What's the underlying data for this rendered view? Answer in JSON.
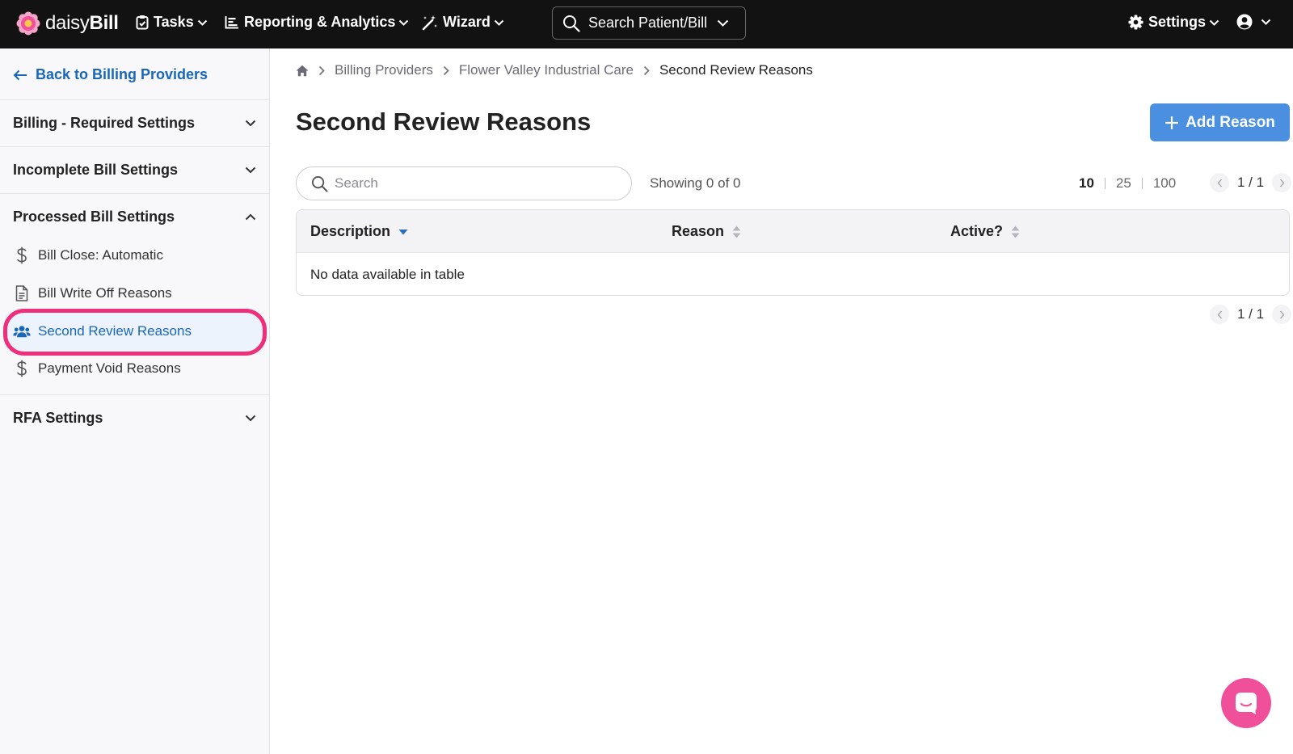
{
  "brand": {
    "name_part1": "daisy",
    "name_part2": "Bill"
  },
  "nav": {
    "tasks": "Tasks",
    "reporting": "Reporting & Analytics",
    "wizard": "Wizard",
    "search": "Search Patient/Bill",
    "settings": "Settings"
  },
  "sidebar": {
    "back_link": "Back to Billing Providers",
    "sections": [
      {
        "label": "Billing - Required Settings",
        "expanded": false
      },
      {
        "label": "Incomplete Bill Settings",
        "expanded": false
      },
      {
        "label": "Processed Bill Settings",
        "expanded": true
      },
      {
        "label": "RFA Settings",
        "expanded": false
      }
    ],
    "items": [
      {
        "label": "Bill Close: Automatic",
        "icon": "dollar-icon"
      },
      {
        "label": "Bill Write Off Reasons",
        "icon": "document-icon"
      },
      {
        "label": "Second Review Reasons",
        "icon": "users-icon",
        "active": true
      },
      {
        "label": "Payment Void Reasons",
        "icon": "dollar-icon"
      }
    ]
  },
  "breadcrumb": {
    "items": [
      "Billing Providers",
      "Flower Valley Industrial Care",
      "Second Review Reasons"
    ]
  },
  "page": {
    "title": "Second Review Reasons",
    "add_button": "Add Reason"
  },
  "table_controls": {
    "search_placeholder": "Search",
    "showing": "Showing 0 of 0",
    "page_sizes": [
      "10",
      "25",
      "100"
    ],
    "selected_page_size": "10",
    "pagination": "1 / 1"
  },
  "table": {
    "columns": [
      "Description",
      "Reason",
      "Active?"
    ],
    "empty_message": "No data available in table"
  },
  "colors": {
    "topbar": "#121212",
    "link": "#1967b8",
    "primary_button": "#4a8fe0",
    "highlight": "#ef2f7b",
    "chat": "#f0509a"
  }
}
